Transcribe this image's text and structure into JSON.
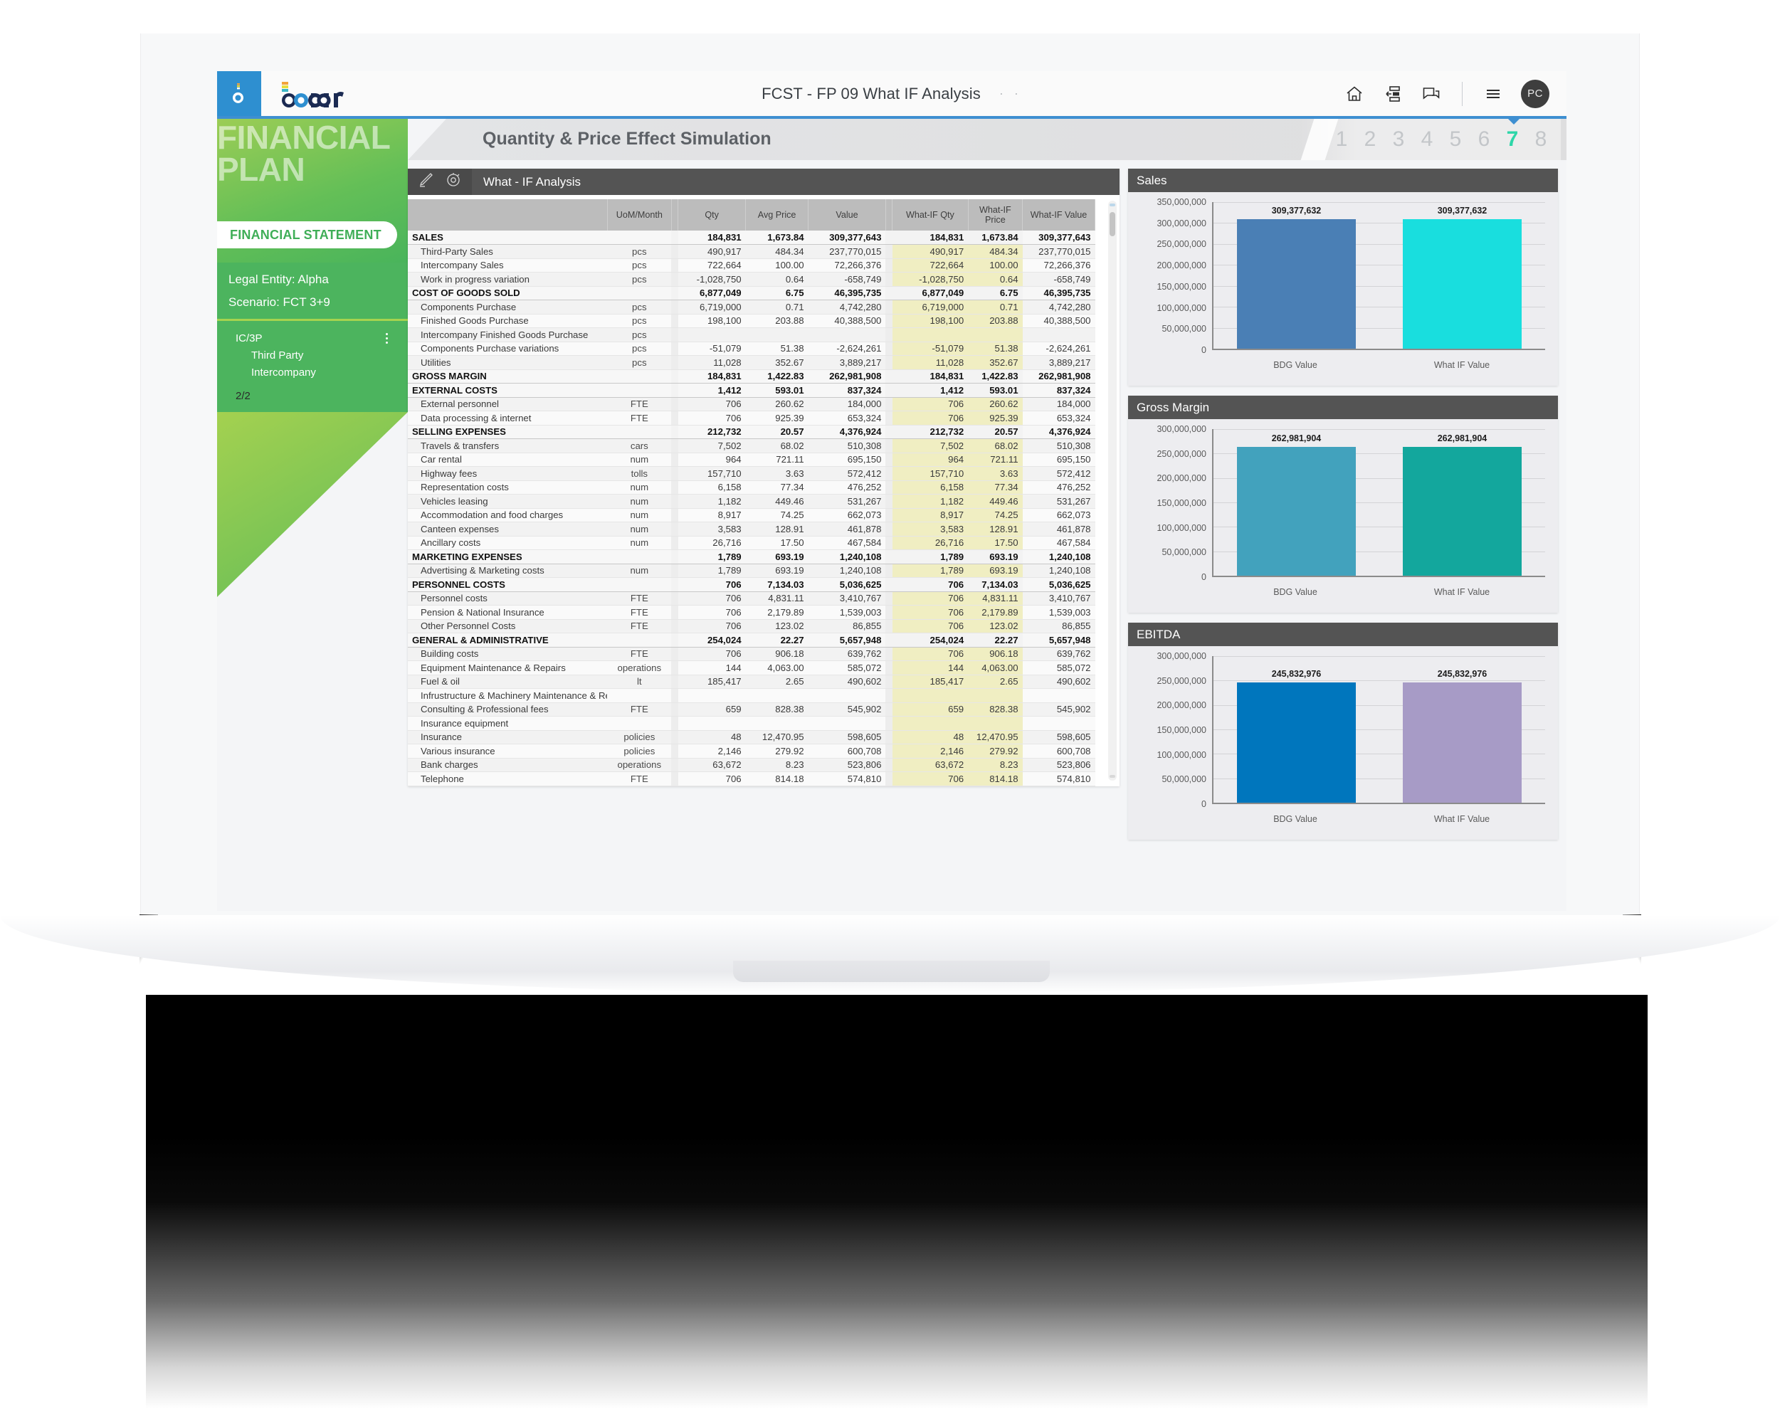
{
  "topbar": {
    "brand": "board",
    "title": "FCST - FP 09 What IF Analysis",
    "title_dots": "· ·",
    "icons": [
      "home-icon",
      "layout-icon",
      "comment-icon",
      "hamburger-icon"
    ],
    "avatar_initials": "PC"
  },
  "sidebar": {
    "hero_title": "FINANCIAL\nPLAN",
    "pill_label": "FINANCIAL STATEMENT",
    "legal_entity": "Legal Entity: Alpha",
    "scenario": "Scenario: FCT 3+9",
    "selector_title": "IC/3P",
    "selector_items": [
      "Third Party",
      "Intercompany"
    ],
    "selection_count": "2/2"
  },
  "page": {
    "header_title": "Quantity & Price Effect Simulation",
    "pager": [
      "1",
      "2",
      "3",
      "4",
      "5",
      "6",
      "7",
      "8"
    ],
    "pager_active": "7"
  },
  "table_card": {
    "title": "What - IF Analysis",
    "tools": [
      "pencil-icon",
      "refresh-gear-icon"
    ]
  },
  "table": {
    "columns": [
      "",
      "UoM/Month",
      "Qty",
      "Avg Price",
      "Value",
      "",
      "What-IF Qty",
      "What-IF Price",
      "What-IF Value"
    ],
    "rows": [
      {
        "type": "grp",
        "label": "SALES",
        "uom": "",
        "qty": "184,831",
        "price": "1,673.84",
        "value": "309,377,643",
        "wqty": "184,831",
        "wprice": "1,673.84",
        "wvalue": "309,377,643"
      },
      {
        "type": "det",
        "label": "Third-Party Sales",
        "uom": "pcs",
        "qty": "490,917",
        "price": "484.34",
        "value": "237,770,015",
        "wqty": "490,917",
        "wprice": "484.34",
        "wvalue": "237,770,015"
      },
      {
        "type": "det",
        "label": "Intercompany Sales",
        "uom": "pcs",
        "qty": "722,664",
        "price": "100.00",
        "value": "72,266,376",
        "wqty": "722,664",
        "wprice": "100.00",
        "wvalue": "72,266,376"
      },
      {
        "type": "det",
        "label": "Work in progress variation",
        "uom": "pcs",
        "qty": "-1,028,750",
        "price": "0.64",
        "value": "-658,749",
        "wqty": "-1,028,750",
        "wprice": "0.64",
        "wvalue": "-658,749"
      },
      {
        "type": "grp",
        "label": "COST OF GOODS SOLD",
        "uom": "",
        "qty": "6,877,049",
        "price": "6.75",
        "value": "46,395,735",
        "wqty": "6,877,049",
        "wprice": "6.75",
        "wvalue": "46,395,735"
      },
      {
        "type": "det",
        "label": "Components Purchase",
        "uom": "pcs",
        "qty": "6,719,000",
        "price": "0.71",
        "value": "4,742,280",
        "wqty": "6,719,000",
        "wprice": "0.71",
        "wvalue": "4,742,280"
      },
      {
        "type": "det",
        "label": "Finished Goods Purchase",
        "uom": "pcs",
        "qty": "198,100",
        "price": "203.88",
        "value": "40,388,500",
        "wqty": "198,100",
        "wprice": "203.88",
        "wvalue": "40,388,500"
      },
      {
        "type": "det",
        "label": "Intercompany Finished Goods Purchase",
        "uom": "pcs",
        "qty": "",
        "price": "",
        "value": "",
        "wqty": "",
        "wprice": "",
        "wvalue": ""
      },
      {
        "type": "det",
        "label": "Components Purchase variations",
        "uom": "pcs",
        "qty": "-51,079",
        "price": "51.38",
        "value": "-2,624,261",
        "wqty": "-51,079",
        "wprice": "51.38",
        "wvalue": "-2,624,261"
      },
      {
        "type": "det",
        "label": "Utilities",
        "uom": "pcs",
        "qty": "11,028",
        "price": "352.67",
        "value": "3,889,217",
        "wqty": "11,028",
        "wprice": "352.67",
        "wvalue": "3,889,217"
      },
      {
        "type": "grp",
        "label": "GROSS MARGIN",
        "uom": "",
        "qty": "184,831",
        "price": "1,422.83",
        "value": "262,981,908",
        "wqty": "184,831",
        "wprice": "1,422.83",
        "wvalue": "262,981,908"
      },
      {
        "type": "grp",
        "label": "EXTERNAL COSTS",
        "uom": "",
        "qty": "1,412",
        "price": "593.01",
        "value": "837,324",
        "wqty": "1,412",
        "wprice": "593.01",
        "wvalue": "837,324"
      },
      {
        "type": "det",
        "label": "External personnel",
        "uom": "FTE",
        "qty": "706",
        "price": "260.62",
        "value": "184,000",
        "wqty": "706",
        "wprice": "260.62",
        "wvalue": "184,000"
      },
      {
        "type": "det",
        "label": "Data processing & internet",
        "uom": "FTE",
        "qty": "706",
        "price": "925.39",
        "value": "653,324",
        "wqty": "706",
        "wprice": "925.39",
        "wvalue": "653,324"
      },
      {
        "type": "grp",
        "label": "SELLING EXPENSES",
        "uom": "",
        "qty": "212,732",
        "price": "20.57",
        "value": "4,376,924",
        "wqty": "212,732",
        "wprice": "20.57",
        "wvalue": "4,376,924"
      },
      {
        "type": "det",
        "label": "Travels & transfers",
        "uom": "cars",
        "qty": "7,502",
        "price": "68.02",
        "value": "510,308",
        "wqty": "7,502",
        "wprice": "68.02",
        "wvalue": "510,308"
      },
      {
        "type": "det",
        "label": "Car rental",
        "uom": "num",
        "qty": "964",
        "price": "721.11",
        "value": "695,150",
        "wqty": "964",
        "wprice": "721.11",
        "wvalue": "695,150"
      },
      {
        "type": "det",
        "label": "Highway fees",
        "uom": "tolls",
        "qty": "157,710",
        "price": "3.63",
        "value": "572,412",
        "wqty": "157,710",
        "wprice": "3.63",
        "wvalue": "572,412"
      },
      {
        "type": "det",
        "label": "Representation costs",
        "uom": "num",
        "qty": "6,158",
        "price": "77.34",
        "value": "476,252",
        "wqty": "6,158",
        "wprice": "77.34",
        "wvalue": "476,252"
      },
      {
        "type": "det",
        "label": "Vehicles leasing",
        "uom": "num",
        "qty": "1,182",
        "price": "449.46",
        "value": "531,267",
        "wqty": "1,182",
        "wprice": "449.46",
        "wvalue": "531,267"
      },
      {
        "type": "det",
        "label": "Accommodation and food charges",
        "uom": "num",
        "qty": "8,917",
        "price": "74.25",
        "value": "662,073",
        "wqty": "8,917",
        "wprice": "74.25",
        "wvalue": "662,073"
      },
      {
        "type": "det",
        "label": "Canteen expenses",
        "uom": "num",
        "qty": "3,583",
        "price": "128.91",
        "value": "461,878",
        "wqty": "3,583",
        "wprice": "128.91",
        "wvalue": "461,878"
      },
      {
        "type": "det",
        "label": "Ancillary costs",
        "uom": "num",
        "qty": "26,716",
        "price": "17.50",
        "value": "467,584",
        "wqty": "26,716",
        "wprice": "17.50",
        "wvalue": "467,584"
      },
      {
        "type": "grp",
        "label": "MARKETING EXPENSES",
        "uom": "",
        "qty": "1,789",
        "price": "693.19",
        "value": "1,240,108",
        "wqty": "1,789",
        "wprice": "693.19",
        "wvalue": "1,240,108"
      },
      {
        "type": "det",
        "label": "Advertising & Marketing costs",
        "uom": "num",
        "qty": "1,789",
        "price": "693.19",
        "value": "1,240,108",
        "wqty": "1,789",
        "wprice": "693.19",
        "wvalue": "1,240,108"
      },
      {
        "type": "grp",
        "label": "PERSONNEL COSTS",
        "uom": "",
        "qty": "706",
        "price": "7,134.03",
        "value": "5,036,625",
        "wqty": "706",
        "wprice": "7,134.03",
        "wvalue": "5,036,625"
      },
      {
        "type": "det",
        "label": "Personnel costs",
        "uom": "FTE",
        "qty": "706",
        "price": "4,831.11",
        "value": "3,410,767",
        "wqty": "706",
        "wprice": "4,831.11",
        "wvalue": "3,410,767"
      },
      {
        "type": "det",
        "label": "Pension & National Insurance",
        "uom": "FTE",
        "qty": "706",
        "price": "2,179.89",
        "value": "1,539,003",
        "wqty": "706",
        "wprice": "2,179.89",
        "wvalue": "1,539,003"
      },
      {
        "type": "det",
        "label": "Other Personnel Costs",
        "uom": "FTE",
        "qty": "706",
        "price": "123.02",
        "value": "86,855",
        "wqty": "706",
        "wprice": "123.02",
        "wvalue": "86,855"
      },
      {
        "type": "grp",
        "label": "GENERAL & ADMINISTRATIVE",
        "uom": "",
        "qty": "254,024",
        "price": "22.27",
        "value": "5,657,948",
        "wqty": "254,024",
        "wprice": "22.27",
        "wvalue": "5,657,948"
      },
      {
        "type": "det",
        "label": "Building costs",
        "uom": "FTE",
        "qty": "706",
        "price": "906.18",
        "value": "639,762",
        "wqty": "706",
        "wprice": "906.18",
        "wvalue": "639,762"
      },
      {
        "type": "det",
        "label": "Equipment Maintenance & Repairs",
        "uom": "operations",
        "qty": "144",
        "price": "4,063.00",
        "value": "585,072",
        "wqty": "144",
        "wprice": "4,063.00",
        "wvalue": "585,072"
      },
      {
        "type": "det",
        "label": "Fuel & oil",
        "uom": "lt",
        "qty": "185,417",
        "price": "2.65",
        "value": "490,602",
        "wqty": "185,417",
        "wprice": "2.65",
        "wvalue": "490,602"
      },
      {
        "type": "det",
        "label": "Infrustructure & Machinery Maintenance & Repa",
        "uom": "",
        "qty": "",
        "price": "",
        "value": "",
        "wqty": "",
        "wprice": "",
        "wvalue": ""
      },
      {
        "type": "det",
        "label": "Consulting & Professional fees",
        "uom": "FTE",
        "qty": "659",
        "price": "828.38",
        "value": "545,902",
        "wqty": "659",
        "wprice": "828.38",
        "wvalue": "545,902"
      },
      {
        "type": "det",
        "label": "Insurance equipment",
        "uom": "",
        "qty": "",
        "price": "",
        "value": "",
        "wqty": "",
        "wprice": "",
        "wvalue": ""
      },
      {
        "type": "det",
        "label": "Insurance",
        "uom": "policies",
        "qty": "48",
        "price": "12,470.95",
        "value": "598,605",
        "wqty": "48",
        "wprice": "12,470.95",
        "wvalue": "598,605"
      },
      {
        "type": "det",
        "label": "Various insurance",
        "uom": "policies",
        "qty": "2,146",
        "price": "279.92",
        "value": "600,708",
        "wqty": "2,146",
        "wprice": "279.92",
        "wvalue": "600,708"
      },
      {
        "type": "det",
        "label": "Bank charges",
        "uom": "operations",
        "qty": "63,672",
        "price": "8.23",
        "value": "523,806",
        "wqty": "63,672",
        "wprice": "8.23",
        "wvalue": "523,806"
      },
      {
        "type": "det",
        "label": "Telephone",
        "uom": "FTE",
        "qty": "706",
        "price": "814.18",
        "value": "574,810",
        "wqty": "706",
        "wprice": "814.18",
        "wvalue": "574,810"
      }
    ]
  },
  "chart_data": [
    {
      "type": "bar",
      "title": "Sales",
      "categories": [
        "BDG Value",
        "What IF Value"
      ],
      "values": [
        309377632,
        309377632
      ],
      "labels": [
        "309,377,632",
        "309,377,632"
      ],
      "colors": [
        "#4a7fb5",
        "#19dede"
      ],
      "ylim": [
        0,
        350000000
      ],
      "yticks": [
        0,
        50000000,
        100000000,
        150000000,
        200000000,
        250000000,
        300000000,
        350000000
      ],
      "ytick_labels": [
        "0",
        "50,000,000",
        "100,000,000",
        "150,000,000",
        "200,000,000",
        "250,000,000",
        "300,000,000",
        "350,000,000"
      ],
      "xlabel": "",
      "ylabel": "",
      "grid": true,
      "legend": "none"
    },
    {
      "type": "bar",
      "title": "Gross Margin",
      "categories": [
        "BDG Value",
        "What IF Value"
      ],
      "values": [
        262981904,
        262981904
      ],
      "labels": [
        "262,981,904",
        "262,981,904"
      ],
      "colors": [
        "#42a2bd",
        "#13a79d"
      ],
      "ylim": [
        0,
        300000000
      ],
      "yticks": [
        0,
        50000000,
        100000000,
        150000000,
        200000000,
        250000000,
        300000000
      ],
      "ytick_labels": [
        "0",
        "50,000,000",
        "100,000,000",
        "150,000,000",
        "200,000,000",
        "250,000,000",
        "300,000,000"
      ],
      "xlabel": "",
      "ylabel": "",
      "grid": true,
      "legend": "none"
    },
    {
      "type": "bar",
      "title": "EBITDA",
      "categories": [
        "BDG Value",
        "What IF Value"
      ],
      "values": [
        245832976,
        245832976
      ],
      "labels": [
        "245,832,976",
        "245,832,976"
      ],
      "colors": [
        "#0076bd",
        "#a79bc6"
      ],
      "ylim": [
        0,
        300000000
      ],
      "yticks": [
        0,
        50000000,
        100000000,
        150000000,
        200000000,
        250000000,
        300000000
      ],
      "ytick_labels": [
        "0",
        "50,000,000",
        "100,000,000",
        "150,000,000",
        "200,000,000",
        "250,000,000",
        "300,000,000"
      ],
      "xlabel": "",
      "ylabel": "",
      "grid": true,
      "legend": "none"
    }
  ]
}
